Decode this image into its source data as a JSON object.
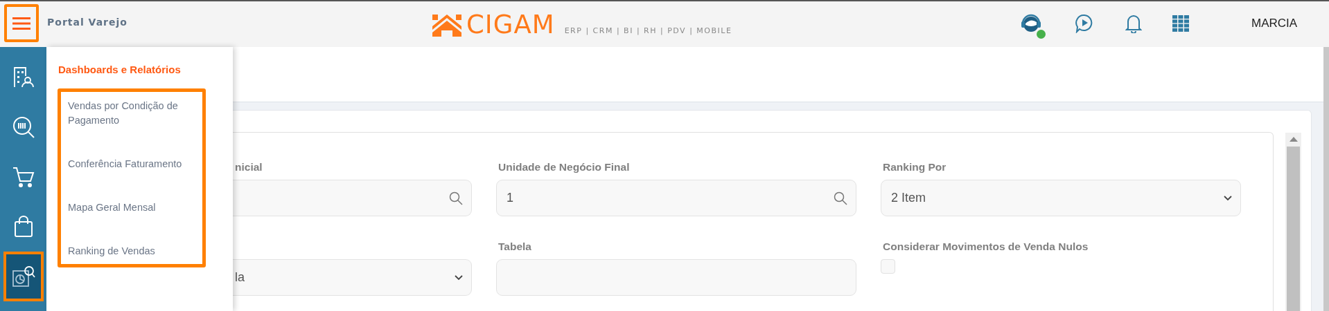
{
  "topbar": {
    "menu_button": {
      "highlighted": true
    },
    "app_title": "Portal Varejo",
    "logo": {
      "name": "CIGAM",
      "tagline": "ERP | CRM | BI | RH | PDV | MOBILE"
    },
    "support": {
      "online": true
    },
    "user": "MARCIA"
  },
  "sidebar": {
    "items": [
      {
        "selected": false,
        "highlighted": false
      },
      {
        "selected": false,
        "highlighted": false
      },
      {
        "selected": false,
        "highlighted": false
      },
      {
        "selected": false,
        "highlighted": false
      },
      {
        "selected": true,
        "highlighted": true
      }
    ]
  },
  "flyout": {
    "title": "Dashboards e Relatórios",
    "highlighted": true,
    "items": [
      {
        "label": "Vendas por Condição de Pagamento"
      },
      {
        "label": "Conferência Faturamento"
      },
      {
        "label": "Mapa Geral Mensal"
      },
      {
        "label": "Ranking de Vendas"
      }
    ]
  },
  "form": {
    "fields": [
      {
        "kind": "lookup",
        "label": "nicial"
      },
      {
        "kind": "lookup",
        "label": "Unidade de Negócio Final",
        "value": "1"
      },
      {
        "kind": "select",
        "label": "Ranking Por",
        "value": "2 Item"
      },
      {
        "kind": "select",
        "value": "la"
      },
      {
        "kind": "text",
        "label": "Tabela"
      },
      {
        "kind": "checkbox",
        "label": "Considerar Movimentos de Venda Nulos",
        "checked": false
      }
    ]
  }
}
